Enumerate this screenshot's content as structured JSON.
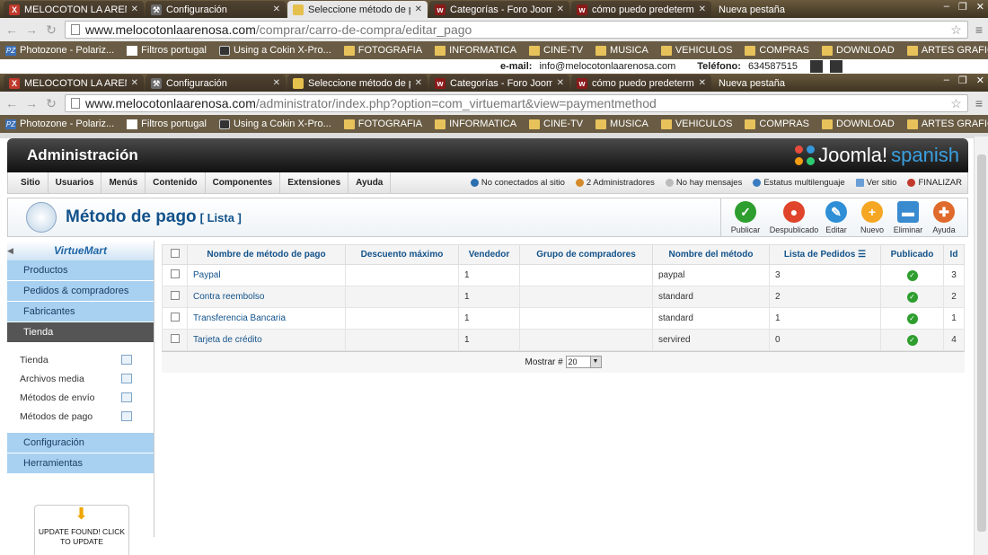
{
  "browser1": {
    "tabs": [
      {
        "label": "MELOCOTON LA ARENOS",
        "color": "#c0392b",
        "fav": "X"
      },
      {
        "label": "Configuración",
        "color": "#6c6c6c",
        "fav": "⚒"
      },
      {
        "label": "Seleccione método de pag",
        "color": "#e5c04c",
        "fav": ""
      },
      {
        "label": "Categorías - Foro Joomla!",
        "color": "#8b1a1a",
        "fav": "w"
      },
      {
        "label": "cómo puedo predetermin",
        "color": "#8b1a1a",
        "fav": "w"
      },
      {
        "label": "Nueva pestaña",
        "color": "",
        "fav": ""
      }
    ],
    "url_domain": "www.melocotonlaarenosa.com",
    "url_path": "/comprar/carro-de-compra/editar_pago"
  },
  "browser2": {
    "tabs": [
      {
        "label": "MELOCOTON LA ARENOS",
        "color": "#c0392b",
        "fav": "X"
      },
      {
        "label": "Configuración",
        "color": "#6c6c6c",
        "fav": "⚒"
      },
      {
        "label": "Seleccione método de pag",
        "color": "#e5c04c",
        "fav": ""
      },
      {
        "label": "Categorías - Foro Joomla!",
        "color": "#8b1a1a",
        "fav": "w"
      },
      {
        "label": "cómo puedo predetermin",
        "color": "#8b1a1a",
        "fav": "w"
      },
      {
        "label": "Nueva pestaña",
        "color": "",
        "fav": ""
      }
    ],
    "url_domain": "www.melocotonlaarenosa.com",
    "url_path": "/administrator/index.php?option=com_virtuemart&view=paymentmethod"
  },
  "bookmarks": [
    "Photozone - Polariz...",
    "Filtros portugal",
    "Using a Cokin X-Pro...",
    "FOTOGRAFIA",
    "INFORMATICA",
    "CINE-TV",
    "MUSICA",
    "VEHICULOS",
    "COMPRAS",
    "DOWNLOAD",
    "ARTES GRAFICAS"
  ],
  "contact": {
    "email_label": "e-mail:",
    "email": "info@melocotonlaarenosa.com",
    "phone_label": "Teléfono:",
    "phone": "634587515"
  },
  "admin": {
    "title": "Administración",
    "brand": "Joomla!",
    "brand_suffix": "spanish"
  },
  "menu": {
    "items": [
      "Sitio",
      "Usuarios",
      "Menús",
      "Contenido",
      "Componentes",
      "Extensiones",
      "Ayuda"
    ],
    "status": [
      "No conectados al sitio",
      "2 Administradores",
      "No hay mensajes",
      "Estatus multilenguaje",
      "Ver sitio",
      "FINALIZAR"
    ]
  },
  "page": {
    "title": "Método de pago",
    "subtitle": "[ Lista ]"
  },
  "toolbar": {
    "publish": "Publicar",
    "unpublish": "Despublicado",
    "edit": "Editar",
    "new": "Nuevo",
    "delete": "Eliminar",
    "help": "Ayuda"
  },
  "sidebar": {
    "logo": "VirtueMart",
    "groups": [
      "Productos",
      "Pedidos & compradores",
      "Fabricantes",
      "Tienda"
    ],
    "subitems": [
      "Tienda",
      "Archivos media",
      "Métodos de envío",
      "Métodos de pago"
    ],
    "bottom_groups": [
      "Configuración",
      "Herramientas"
    ],
    "update_text": "UPDATE FOUND! CLICK TO UPDATE"
  },
  "table": {
    "headers": [
      "Nombre de método de pago",
      "Descuento máximo",
      "Vendedor",
      "Grupo de compradores",
      "Nombre del método",
      "Lista de Pedidos",
      "Publicado",
      "Id"
    ],
    "rows": [
      {
        "name": "Paypal",
        "discount": "",
        "vendor": "1",
        "group": "",
        "method": "paypal",
        "order": "3",
        "id": "3"
      },
      {
        "name": "Contra reembolso",
        "discount": "",
        "vendor": "1",
        "group": "",
        "method": "standard",
        "order": "2",
        "id": "2"
      },
      {
        "name": "Transferencia Bancaria",
        "discount": "",
        "vendor": "1",
        "group": "",
        "method": "standard",
        "order": "1",
        "id": "1"
      },
      {
        "name": "Tarjeta de crédito",
        "discount": "",
        "vendor": "1",
        "group": "",
        "method": "servired",
        "order": "0",
        "id": "4"
      }
    ],
    "show_label": "Mostrar #",
    "show_value": "20"
  }
}
